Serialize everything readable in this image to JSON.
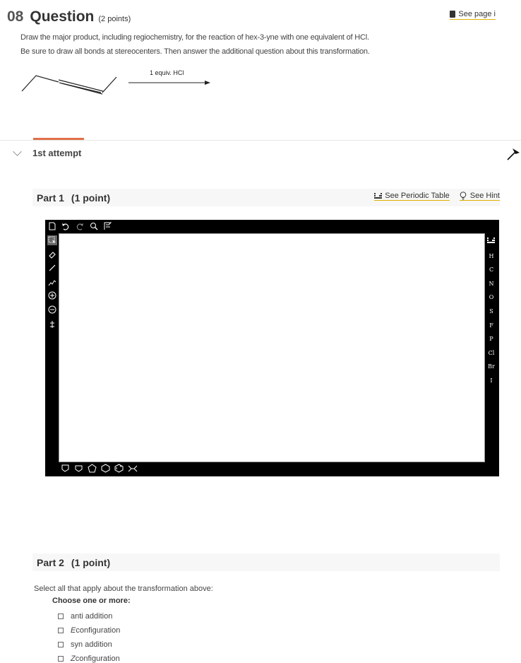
{
  "question": {
    "number": "08",
    "title": "Question",
    "points": "(2 points)",
    "see_page": "See page i",
    "prompt_line1": "Draw the major product, including regiochemistry, for the reaction of hex-3-yne with one equivalent of HCl.",
    "prompt_line2": "Be sure to draw all bonds at stereocenters. Then answer the additional question about this transformation.",
    "reagent": "1 equiv. HCl"
  },
  "attempt": {
    "label": "1st attempt"
  },
  "part1": {
    "title": "Part 1",
    "points": "(1 point)",
    "periodic_table": "See Periodic Table",
    "hint": "See Hint"
  },
  "editor": {
    "elements": [
      "H",
      "C",
      "N",
      "O",
      "S",
      "F",
      "P",
      "Cl",
      "Br",
      "I"
    ]
  },
  "part2": {
    "title": "Part 2",
    "points": "(1 point)",
    "question": "Select all that apply about the transformation above:",
    "choose": "Choose one or more:",
    "options": [
      {
        "prefix": "",
        "italic": "",
        "text": "anti addition"
      },
      {
        "prefix": "",
        "italic": "E",
        "text": " configuration"
      },
      {
        "prefix": "",
        "italic": "",
        "text": "syn addition"
      },
      {
        "prefix": "",
        "italic": "Z",
        "text": " configuration"
      }
    ]
  }
}
